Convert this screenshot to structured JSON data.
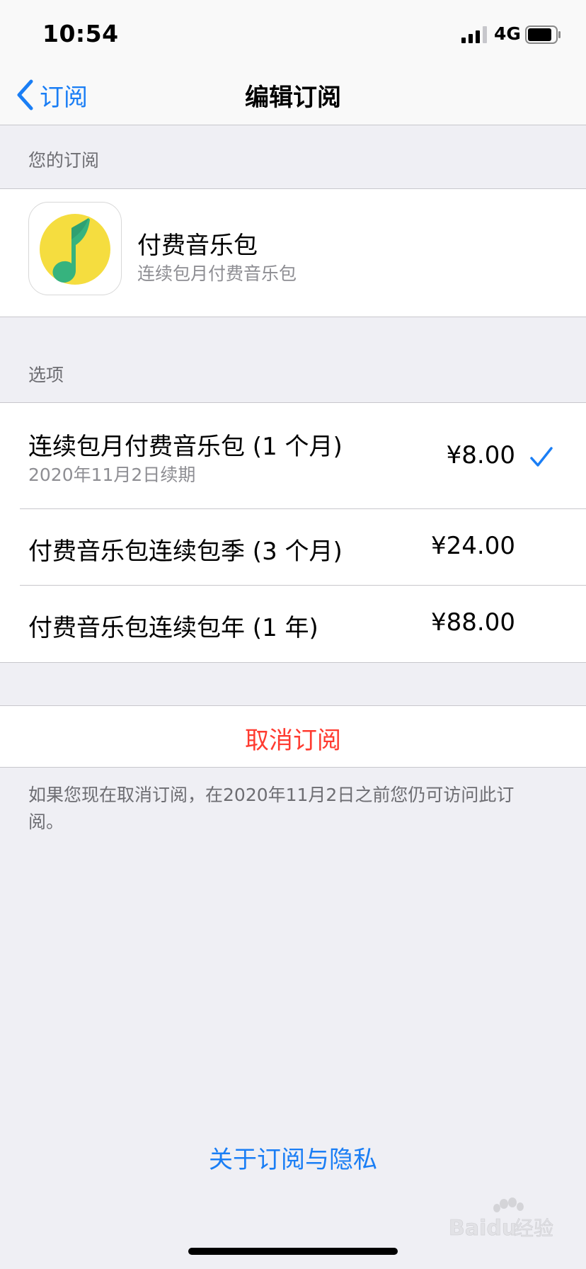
{
  "status_bar": {
    "time": "10:54",
    "network": "4G",
    "signal_icon": "cellular-signal-icon",
    "battery_icon": "battery-icon"
  },
  "nav": {
    "back_label": "订阅",
    "back_icon": "chevron-left-icon",
    "title": "编辑订阅"
  },
  "subscription_section": {
    "header": "您的订阅",
    "app": {
      "name": "付费音乐包",
      "description": "连续包月付费音乐包",
      "icon": "music-app-icon"
    }
  },
  "options_section": {
    "header": "选项",
    "options": [
      {
        "title": "连续包月付费音乐包 (1 个月)",
        "subtitle": "2020年11月2日续期",
        "price": "¥8.00",
        "selected": true
      },
      {
        "title": "付费音乐包连续包季 (3 个月)",
        "subtitle": "",
        "price": "¥24.00",
        "selected": false
      },
      {
        "title": "付费音乐包连续包年 (1 年)",
        "subtitle": "",
        "price": "¥88.00",
        "selected": false
      }
    ]
  },
  "cancel": {
    "label": "取消订阅",
    "note": "如果您现在取消订阅，在2020年11月2日之前您仍可访问此订阅。"
  },
  "footer": {
    "privacy_link": "关于订阅与隐私"
  },
  "watermark": {
    "text": "Baidu经验",
    "icon": "baidu-paw-icon"
  },
  "colors": {
    "accent": "#1a7ef5",
    "destructive": "#ff3b30",
    "background": "#efeff4",
    "secondary_text": "#8e8e93"
  }
}
